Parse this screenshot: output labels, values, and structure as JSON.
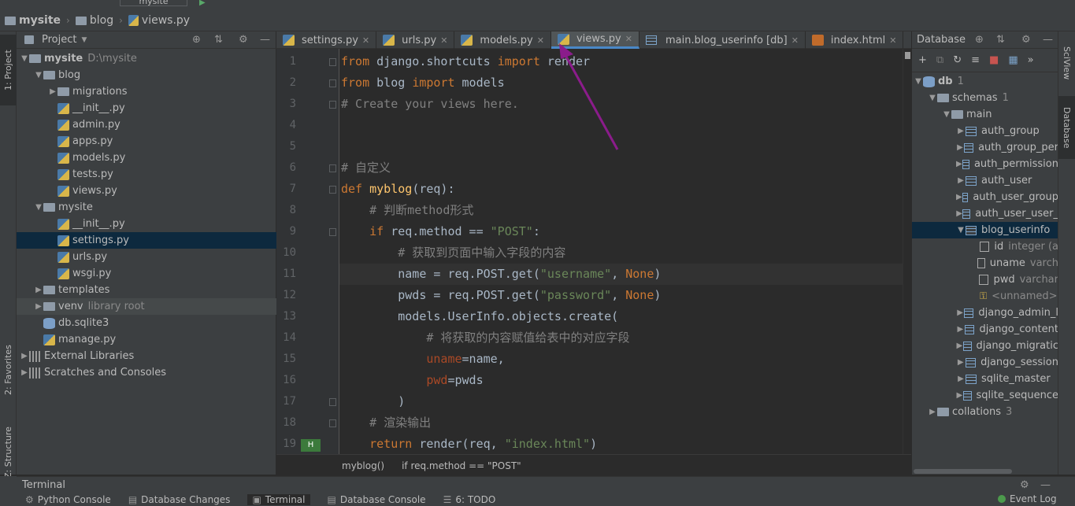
{
  "nav": {
    "project": "mysite",
    "folder": "blog",
    "file": "views.py",
    "run_config": "mysite"
  },
  "left_strip": {
    "project_tab": "1: Project",
    "favorites_tab": "2: Favorites",
    "structure_tab": "Z: Structure"
  },
  "project_panel": {
    "title": "Project",
    "tree": [
      {
        "label": "mysite",
        "hint": "D:\\mysite",
        "type": "folder",
        "depth": 0,
        "expanded": true,
        "bold": true
      },
      {
        "label": "blog",
        "type": "folder",
        "depth": 1,
        "expanded": true
      },
      {
        "label": "migrations",
        "type": "folder",
        "depth": 2,
        "expanded": false
      },
      {
        "label": "__init__.py",
        "type": "py",
        "depth": 2
      },
      {
        "label": "admin.py",
        "type": "py",
        "depth": 2
      },
      {
        "label": "apps.py",
        "type": "py",
        "depth": 2
      },
      {
        "label": "models.py",
        "type": "py",
        "depth": 2
      },
      {
        "label": "tests.py",
        "type": "py",
        "depth": 2
      },
      {
        "label": "views.py",
        "type": "py",
        "depth": 2
      },
      {
        "label": "mysite",
        "type": "folder",
        "depth": 1,
        "expanded": true
      },
      {
        "label": "__init__.py",
        "type": "py",
        "depth": 2
      },
      {
        "label": "settings.py",
        "type": "py",
        "depth": 2,
        "selected": true
      },
      {
        "label": "urls.py",
        "type": "py",
        "depth": 2
      },
      {
        "label": "wsgi.py",
        "type": "py",
        "depth": 2
      },
      {
        "label": "templates",
        "type": "folder",
        "depth": 1,
        "expanded": false
      },
      {
        "label": "venv",
        "hint": "library root",
        "type": "folder",
        "depth": 1,
        "expanded": false,
        "shaded": true
      },
      {
        "label": "db.sqlite3",
        "type": "db",
        "depth": 1
      },
      {
        "label": "manage.py",
        "type": "py",
        "depth": 1
      },
      {
        "label": "External Libraries",
        "type": "lib",
        "depth": 0,
        "expanded": false
      },
      {
        "label": "Scratches and Consoles",
        "type": "lib",
        "depth": 0,
        "expanded": false
      }
    ]
  },
  "tabs": [
    {
      "label": "settings.py",
      "icon": "py"
    },
    {
      "label": "urls.py",
      "icon": "py"
    },
    {
      "label": "models.py",
      "icon": "py"
    },
    {
      "label": "views.py",
      "icon": "py",
      "active": true
    },
    {
      "label": "main.blog_userinfo [db]",
      "icon": "table"
    },
    {
      "label": "index.html",
      "icon": "html"
    }
  ],
  "editor": {
    "line_numbers": [
      "1",
      "2",
      "3",
      "4",
      "5",
      "6",
      "7",
      "8",
      "9",
      "10",
      "11",
      "12",
      "13",
      "14",
      "15",
      "16",
      "17",
      "18",
      "19"
    ],
    "current_line": 11,
    "breadcrumb": [
      "myblog()",
      "if req.method == \"POST\""
    ]
  },
  "db_panel": {
    "title": "Database",
    "tree": [
      {
        "label": "db",
        "count": "1",
        "depth": 0,
        "kind": "db",
        "expanded": true
      },
      {
        "label": "schemas",
        "count": "1",
        "depth": 1,
        "kind": "folder",
        "expanded": true
      },
      {
        "label": "main",
        "depth": 2,
        "kind": "schema",
        "expanded": true
      },
      {
        "label": "auth_group",
        "depth": 3,
        "kind": "table"
      },
      {
        "label": "auth_group_per",
        "depth": 3,
        "kind": "table"
      },
      {
        "label": "auth_permission",
        "depth": 3,
        "kind": "table"
      },
      {
        "label": "auth_user",
        "depth": 3,
        "kind": "table"
      },
      {
        "label": "auth_user_group",
        "depth": 3,
        "kind": "table"
      },
      {
        "label": "auth_user_user_",
        "depth": 3,
        "kind": "table"
      },
      {
        "label": "blog_userinfo",
        "depth": 3,
        "kind": "table",
        "expanded": true,
        "selected": true
      },
      {
        "label": "id",
        "hint": "integer (a",
        "depth": 4,
        "kind": "keycol"
      },
      {
        "label": "uname",
        "hint": "varch",
        "depth": 4,
        "kind": "col"
      },
      {
        "label": "pwd",
        "hint": "varchar",
        "depth": 4,
        "kind": "col"
      },
      {
        "label": "<unnamed>",
        "depth": 4,
        "kind": "key"
      },
      {
        "label": "django_admin_l",
        "depth": 3,
        "kind": "table"
      },
      {
        "label": "django_content",
        "depth": 3,
        "kind": "table"
      },
      {
        "label": "django_migratic",
        "depth": 3,
        "kind": "table"
      },
      {
        "label": "django_session",
        "depth": 3,
        "kind": "table"
      },
      {
        "label": "sqlite_master",
        "depth": 3,
        "kind": "table"
      },
      {
        "label": "sqlite_sequence",
        "depth": 3,
        "kind": "table"
      },
      {
        "label": "collations",
        "count": "3",
        "depth": 1,
        "kind": "folder"
      }
    ]
  },
  "right_strip": {
    "sciview": "SciView",
    "database": "Database"
  },
  "terminal": {
    "title": "Terminal"
  },
  "bottom_tabs": [
    "Python Console",
    "Database Changes",
    "Terminal",
    "Database Console",
    "6: TODO"
  ],
  "event_log": "Event Log"
}
